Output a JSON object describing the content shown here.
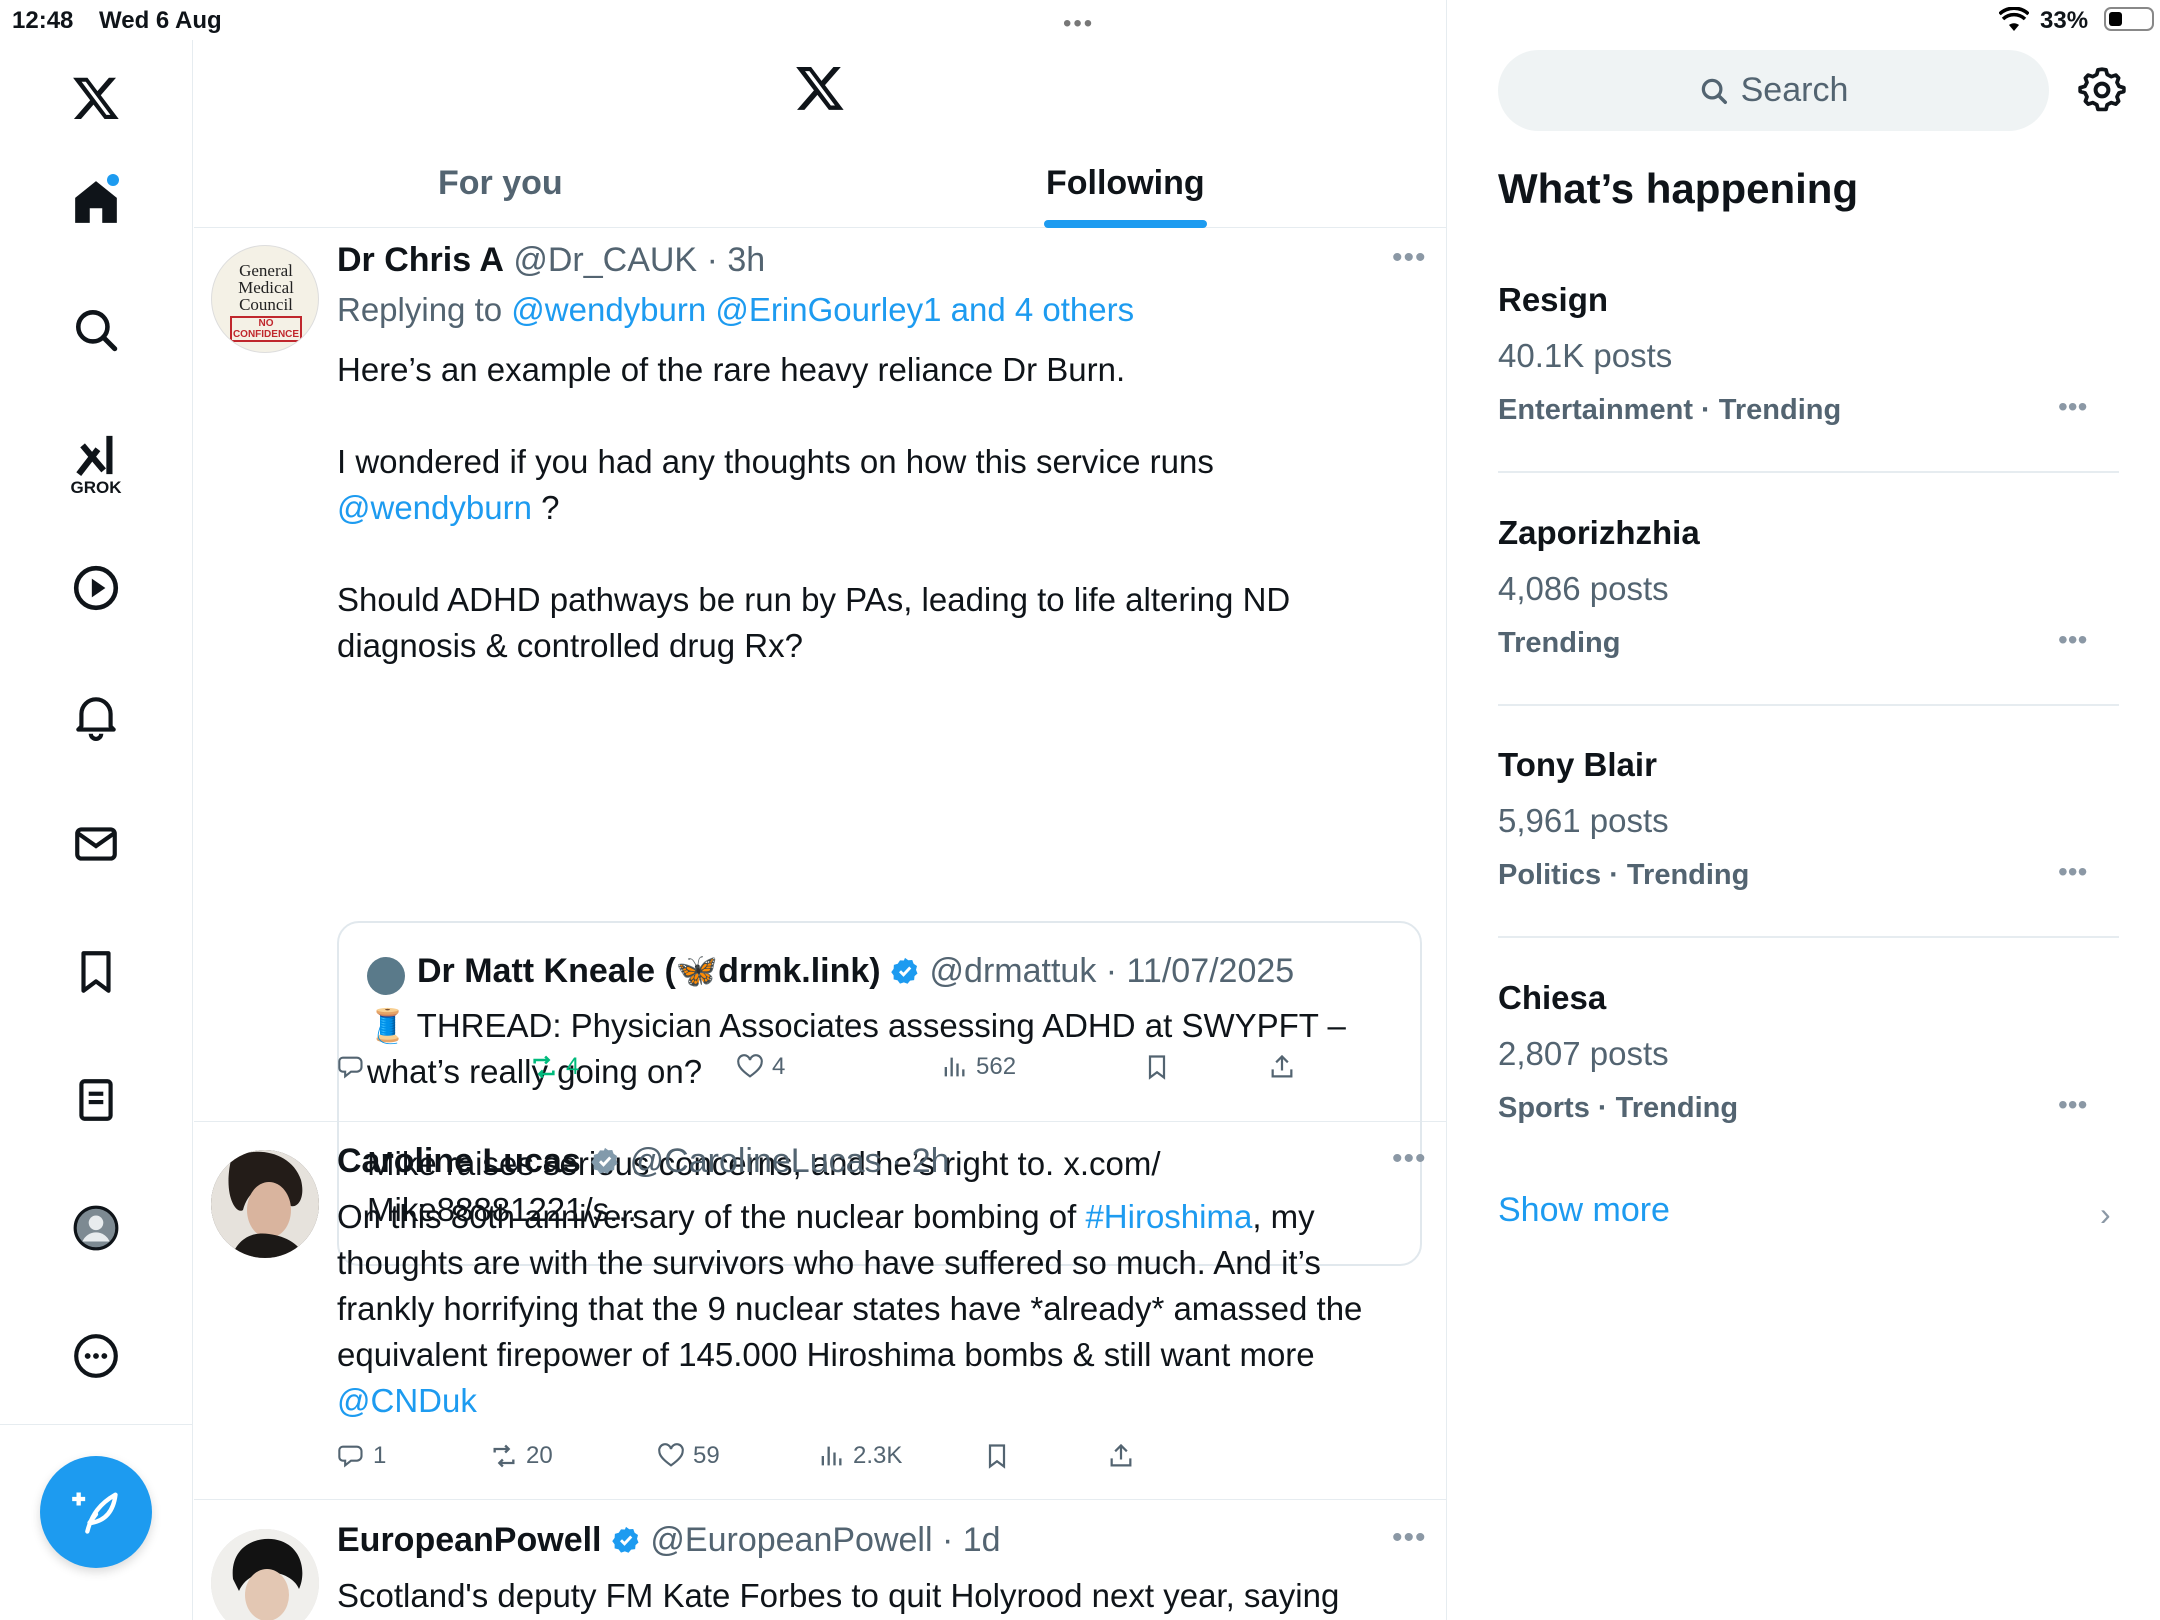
{
  "status_bar": {
    "time": "12:48",
    "date": "Wed 6 Aug",
    "battery": "33%"
  },
  "tabs": {
    "for_you": "For you",
    "following": "Following"
  },
  "tweets": [
    {
      "name": "Dr Chris A",
      "handle": "@Dr_CAUK",
      "time": "· 3h",
      "reply_prefix": "Replying to",
      "reply_to": "@wendyburn @ErinGourley1 and 4 others",
      "avatar_text": [
        "General",
        "Medical",
        "Council"
      ],
      "avatar_badge": "NO CONFIDENCE",
      "body_1": "Here’s an example of the rare heavy reliance Dr Burn.",
      "body_2": "I wondered if you had any thoughts on how this service runs",
      "body_mention": "@wendyburn",
      "body_mention_after": " ?",
      "body_3": "Should ADHD pathways be run by PAs, leading to life altering ND diagnosis & controlled drug Rx?",
      "quote": {
        "name": "Dr Matt Kneale (🦋drmk.link)",
        "handle": "@drmattuk",
        "date": "· 11/07/2025",
        "line_1": "🧵 THREAD: Physician Associates assessing ADHD at SWYPFT – what’s really going on?",
        "line_2": "Mike raises serious concerns, and he’s right to. x.com/ Mike88881221/s..."
      },
      "actions": {
        "reply": "",
        "retweet": "4",
        "like": "4",
        "views": "562"
      }
    },
    {
      "name": "Caroline Lucas",
      "handle": "@CarolineLucas",
      "time": "· 2h",
      "body_pre": "On this 80th anniversary of the nuclear bombing of ",
      "hashtag": "#Hiroshima",
      "body_post": ", my thoughts are with the survivors who have suffered so much. And it’s frankly horrifying that the 9 nuclear states have *already* amassed the equivalent firepower of 145.000 Hiroshima bombs & still want more",
      "mention": "@CNDuk",
      "actions": {
        "reply": "1",
        "retweet": "20",
        "like": "59",
        "views": "2.3K"
      }
    },
    {
      "name": "EuropeanPowell",
      "handle": "@EuropeanPowell",
      "time": "· 1d",
      "body": "Scotland's deputy FM Kate Forbes to quit Holyrood next year, saying"
    }
  ],
  "sidebar": {
    "search_placeholder": "Search",
    "heading": "What’s happening",
    "trends": [
      {
        "name": "Resign",
        "posts": "40.1K posts",
        "category": "Entertainment · Trending"
      },
      {
        "name": "Zaporizhzhia",
        "posts": "4,086 posts",
        "category": "Trending"
      },
      {
        "name": "Tony Blair",
        "posts": "5,961 posts",
        "category": "Politics · Trending"
      },
      {
        "name": "Chiesa",
        "posts": "2,807 posts",
        "category": "Sports · Trending"
      }
    ],
    "show_more": "Show more"
  },
  "nav": {
    "grok_label": "GROK"
  },
  "colors": {
    "accent": "#1d9bf0",
    "retweet_active": "#00ba7c",
    "text": "#0f1419",
    "secondary": "#536471"
  }
}
